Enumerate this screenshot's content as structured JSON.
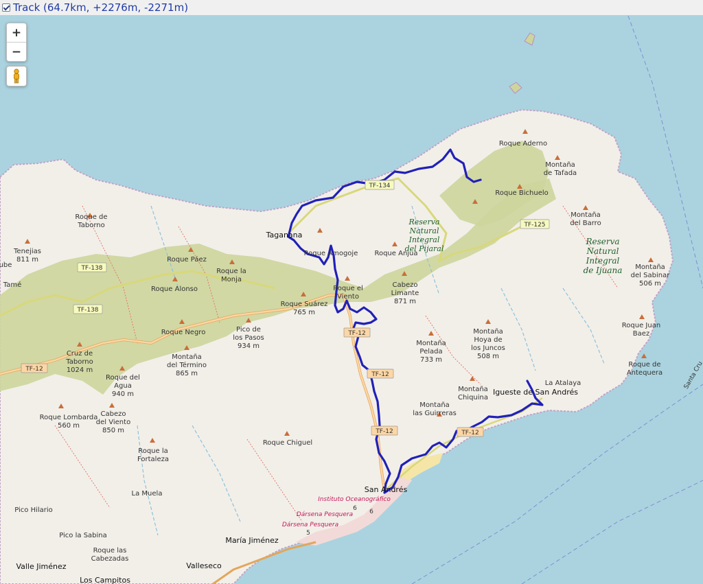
{
  "header": {
    "checkbox_checked": true,
    "track_title": "Track (64.7km, +2276m, -2271m)"
  },
  "controls": {
    "zoom_in": "+",
    "zoom_out": "−",
    "street_view_icon": "pegman-icon"
  },
  "colors": {
    "sea": "#aad3df",
    "land": "#f2efe9",
    "forest": "#c9d29b",
    "track": "#2121b8",
    "road_major": "#fcd6a4",
    "road_secondary": "#f7fabf",
    "urban": "#f2dad9",
    "coastline_boundary": "#b88dbf"
  },
  "map": {
    "peaks": {
      "roque_aderno": "Roque Aderno",
      "montana_tafada": [
        "Montaña",
        "de Tafada"
      ],
      "roque_bichuelo": "Roque Bichuelo",
      "montana_barro": [
        "Montaña",
        "del Barro"
      ],
      "montana_sabinar": [
        "Montaña",
        "del Sabinar",
        "506 m"
      ],
      "roque_juan_baez": [
        "Roque Juan",
        "Baez"
      ],
      "roque_antequera": [
        "Roque de",
        "Antequera"
      ],
      "la_atalaya": "La Atalaya",
      "roque_taborno": [
        "Roque de",
        "Taborno"
      ],
      "tenejias": [
        "Tenejias",
        "811 m"
      ],
      "roque_paez": "Roque Páez",
      "roque_monja": [
        "Roque la",
        "Monja"
      ],
      "roque_alonso": "Roque Alonso",
      "roque_negro": "Roque Negro",
      "pico_pasos": [
        "Pico de",
        "los Pasos",
        "934 m"
      ],
      "cruz_taborno": [
        "Cruz de",
        "Taborno",
        "1024 m"
      ],
      "montana_termino": [
        "Montaña",
        "del Término",
        "865 m"
      ],
      "roque_agua": [
        "Roque del",
        "Agua",
        "940 m"
      ],
      "roque_lombarda": [
        "Roque Lombarda",
        "560 m"
      ],
      "cabezo_viento": [
        "Cabezo",
        "del Viento",
        "850 m"
      ],
      "roque_fortaleza": [
        "Roque la",
        "Fortaleza"
      ],
      "la_muela": "La Muela",
      "pico_hilario": "Pico Hilario",
      "pico_sabina": "Pico la Sabina",
      "roque_cabezadas": [
        "Roque las",
        "Cabezadas"
      ],
      "roque_chiguel": "Roque Chiguel",
      "roque_suarez": [
        "Roque Suárez",
        "765 m"
      ],
      "roque_el_viento": [
        "Roque el",
        "Viento"
      ],
      "cabezo_limante": [
        "Cabezo",
        "Limante",
        "871 m"
      ],
      "roque_anjua": "Roque Anjua",
      "roque_amogoje": "Roque Amogoje",
      "montana_pelada": [
        "Montaña",
        "Pelada",
        "733 m"
      ],
      "montana_hoya": [
        "Montaña",
        "Hoya de",
        "los Juncos",
        "508 m"
      ],
      "montana_chiquina": [
        "Montaña",
        "Chiquina"
      ],
      "montana_guirreras": [
        "Montaña",
        "las Guirreras"
      ]
    },
    "towns": {
      "taganana": "Taganana",
      "san_andres": "San Andrés",
      "igueste": "Igueste de San Andrés",
      "maria_jimenez": "María Jiménez",
      "valleseco": "Valleseco",
      "valle_jimenez": "Valle Jiménez",
      "los_campitos": "Los Campitos",
      "tame": "Tamé",
      "cube": "ube"
    },
    "reserves": {
      "pijaral": [
        "Reserva",
        "Natural",
        "Integral",
        "del Pijaral"
      ],
      "ijuana": [
        "Reserva",
        "Natural",
        "Integral",
        "de Ijuana"
      ]
    },
    "roads": {
      "tf134": "TF-134",
      "tf125": "TF-125",
      "tf138a": "TF-138",
      "tf138b": "TF-138",
      "tf12a": "TF-12",
      "tf12b": "TF-12",
      "tf12c": "TF-12",
      "tf12d": "TF-12",
      "tf12e": "TF-12"
    },
    "port": {
      "instituto": "Instituto Oceanográfico",
      "darsena1": "Dársena Pesquera",
      "darsena2": "Dársena Pesquera",
      "n6a": "6",
      "n6b": "6",
      "n5": "5"
    },
    "edge_text": "Santa Cru"
  }
}
